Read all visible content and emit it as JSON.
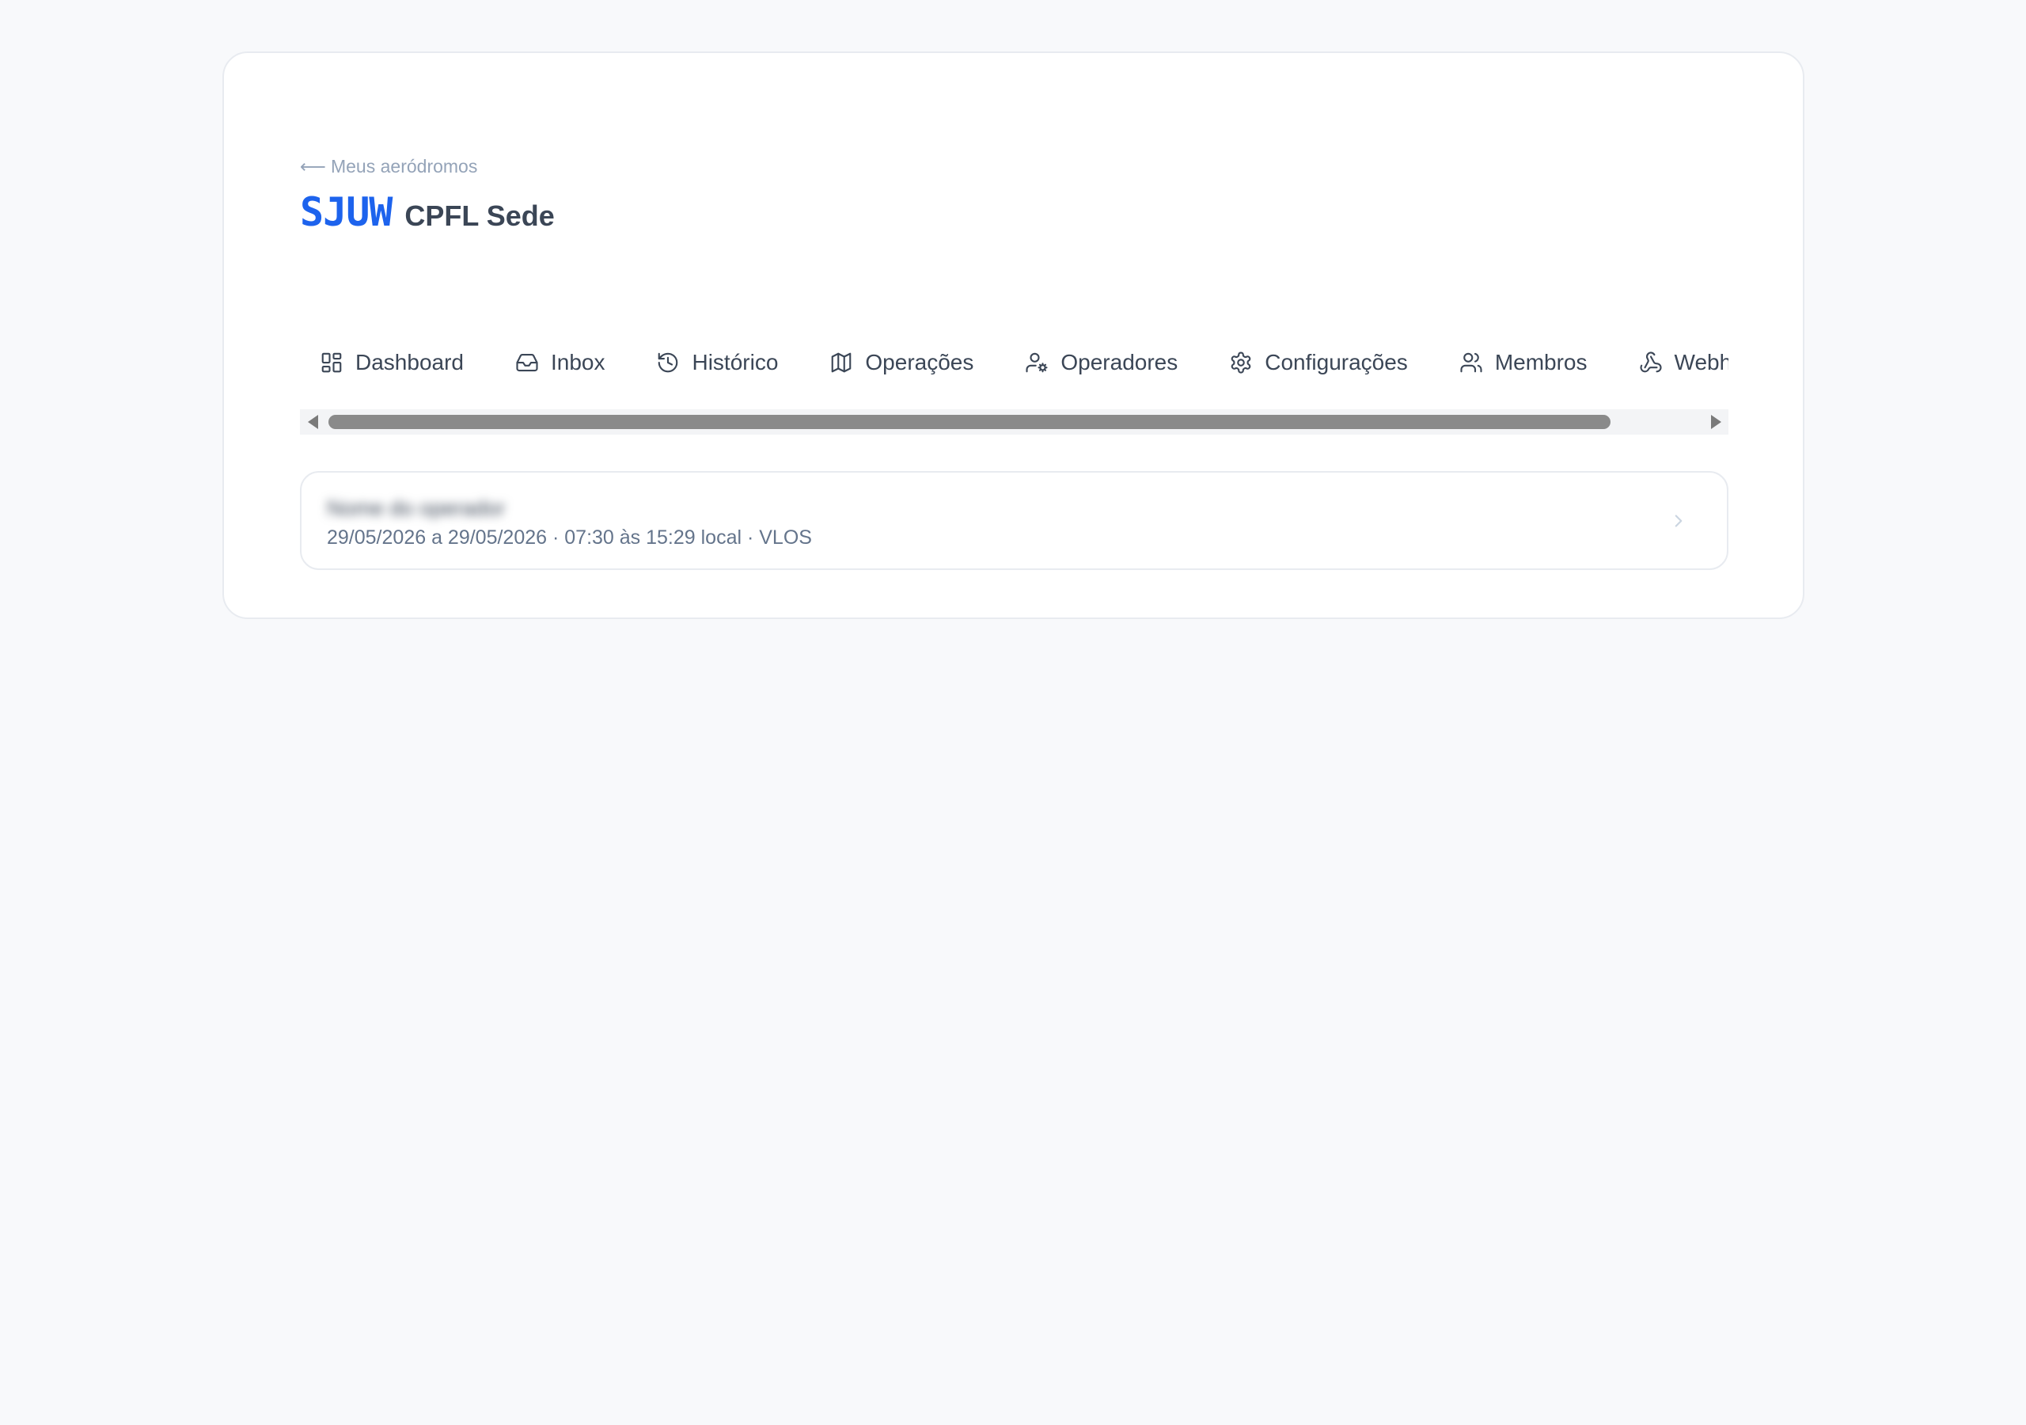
{
  "header": {
    "back_arrow": "⟵",
    "back_label": "Meus aeródromos",
    "code": "SJUW",
    "name": "CPFL Sede"
  },
  "tabs": [
    {
      "label": "Dashboard",
      "icon": "dashboard-icon"
    },
    {
      "label": "Inbox",
      "icon": "inbox-icon"
    },
    {
      "label": "Histórico",
      "icon": "history-icon"
    },
    {
      "label": "Operações",
      "icon": "map-icon"
    },
    {
      "label": "Operadores",
      "icon": "user-gear-icon"
    },
    {
      "label": "Configurações",
      "icon": "gear-icon"
    },
    {
      "label": "Membros",
      "icon": "users-icon"
    },
    {
      "label": "Webhooks",
      "icon": "webhook-icon"
    }
  ],
  "operations": [
    {
      "title": "Nome do operador",
      "meta": "29/05/2026 a 29/05/2026 · 07:30 às 15:29 local · VLOS"
    }
  ],
  "colors": {
    "accent": "#1d63ed",
    "text": "#3b4656",
    "muted": "#94a3b8",
    "background": "#f8f9fb"
  }
}
